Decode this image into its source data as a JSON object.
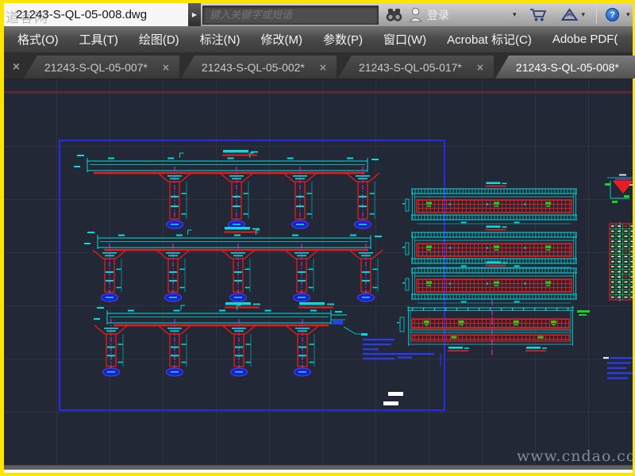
{
  "window": {
    "title": "21243-S-QL-05-008.dwg",
    "overlay_watermark": "道客网"
  },
  "titlebar": {
    "search_placeholder": "键入关键字或短语",
    "login_label": "登录"
  },
  "icons": {
    "close": "×",
    "caret": "▾",
    "play": "▶",
    "help": "?"
  },
  "menu": {
    "items": [
      "格式(O)",
      "工具(T)",
      "绘图(D)",
      "标注(N)",
      "修改(M)",
      "参数(P)",
      "窗口(W)",
      "Acrobat 标记(C)",
      "Adobe PDF("
    ]
  },
  "tabs": [
    {
      "label": "21243-S-QL-05-007*",
      "active": false
    },
    {
      "label": "21243-S-QL-05-002*",
      "active": false
    },
    {
      "label": "21243-S-QL-05-017*",
      "active": false
    },
    {
      "label": "21243-S-QL-05-008*",
      "active": true
    }
  ],
  "canvas": {
    "watermark": "www.cndao.com",
    "colors": {
      "background": "#222836",
      "grid": "#2c3443",
      "frame_blue": "#2a2aee",
      "top_red_line": "#8b2026",
      "cad_cyan": "#00dede",
      "cad_red": "#e81c1c",
      "cad_magenta": "#e232e2",
      "cad_green": "#1ecf1e",
      "cad_blue": "#2b3cf0",
      "foundation_blue": "#1f1fc8",
      "white_mark": "#ffffff",
      "watermark_gray": "#8f969e"
    }
  }
}
